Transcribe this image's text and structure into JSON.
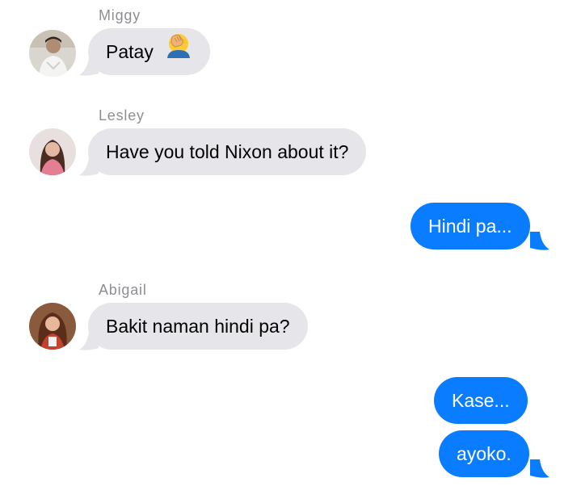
{
  "colors": {
    "incoming_bubble": "#e5e5ea",
    "outgoing_bubble": "#0a7cff",
    "sender_name": "#8e8e93"
  },
  "messages": [
    {
      "direction": "incoming",
      "sender": "Miggy",
      "text": "Patay",
      "icon": "facepalm-emoji"
    },
    {
      "direction": "incoming",
      "sender": "Lesley",
      "text": "Have you told Nixon about it?"
    },
    {
      "direction": "outgoing",
      "text": "Hindi pa..."
    },
    {
      "direction": "incoming",
      "sender": "Abigail",
      "text": "Bakit naman hindi pa?"
    },
    {
      "direction": "outgoing",
      "text": "Kase..."
    },
    {
      "direction": "outgoing",
      "text": "ayoko."
    }
  ]
}
